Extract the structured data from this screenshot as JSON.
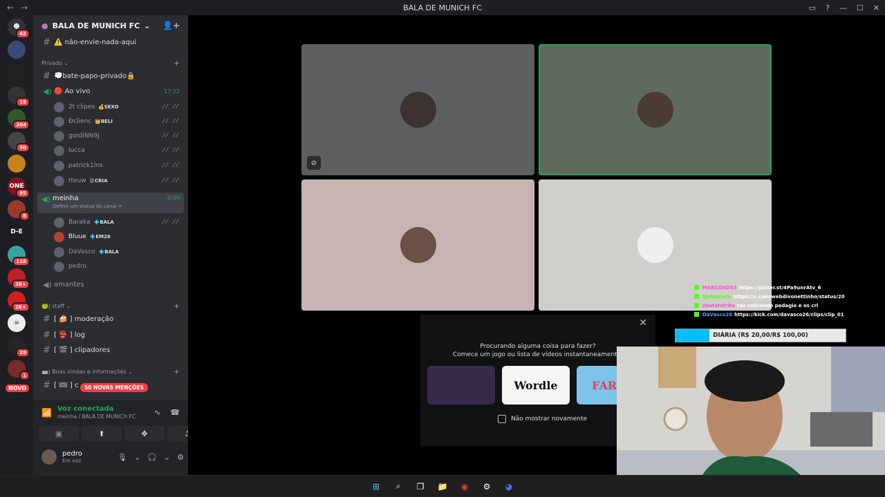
{
  "window": {
    "title": "BALA DE MUNICH FC"
  },
  "server": {
    "name": "BALA DE MUNICH FC"
  },
  "guild_badges": [
    "42",
    "15",
    "204",
    "50",
    "95",
    "8",
    "116",
    "2K+",
    "2K+",
    "29",
    "1"
  ],
  "guild_label": "D-E",
  "novo_label": "NOVO",
  "channels": {
    "top_channel": "⚠️ não-envie-nada-aqui",
    "cat_privado": "Privado",
    "bate_papo": "💭bate-papo-privado🔒",
    "ao_vivo": {
      "name": "🔴 Ao vivo",
      "time": "17:22"
    },
    "ao_vivo_users": [
      {
        "name": "2t clipes",
        "tag": "💰SEXO"
      },
      {
        "name": "Ðclienc",
        "tag": "👑BELI"
      },
      {
        "name": "gordiNN9j",
        "tag": ""
      },
      {
        "name": "lucca",
        "tag": ""
      },
      {
        "name": "patrick1lns",
        "tag": ""
      },
      {
        "name": "tteuw",
        "tag": "😮CRIA"
      }
    ],
    "meinha": {
      "name": "meinha",
      "time": "0:00",
      "status": "Definir um status do canal ✏"
    },
    "meinha_users": [
      {
        "name": "Baraka",
        "tag": "💠BALA"
      },
      {
        "name": "Bluue",
        "tag": "💠EM26"
      },
      {
        "name": "DaVasco",
        "tag": "💠BALA"
      },
      {
        "name": "pedro",
        "tag": ""
      }
    ],
    "amantes": "amantes",
    "cat_staff": "🐸| staff",
    "moderacao": "[ 🍰 ] moderação",
    "log": "[ 👺 ] log",
    "clipadores": "[ 🎬 ] clipadores",
    "cat_boas_vindas": "🚌| Boas vindas e informações",
    "partial_channel": "[ 🎟 ] c",
    "mentions_badge": "50 NOVAS MENÇÕES"
  },
  "voice_panel": {
    "title": "Voz conectada",
    "subtitle": "meinha / BALA DE MUNICH FC"
  },
  "user": {
    "name": "pedro",
    "status": "Em voz"
  },
  "popup": {
    "line1": "Procurando alguma coisa para fazer?",
    "line2": "Comece um jogo ou lista de vídeos instantaneamente.",
    "activities": [
      "",
      "Wordle",
      "FARM"
    ],
    "checkbox_label": "Não mostrar novamente"
  },
  "chat": [
    {
      "user": "MARCOXD03",
      "color": "#ff4fd8",
      "text": "https://pinter.st/4Pa9unrAtv_6"
    },
    {
      "user": "igatopreto",
      "color": "#53fc18",
      "text": "https://x.com/webdivonettinho/status/20"
    },
    {
      "user": "zbatatafrita",
      "color": "#ff4fd8",
      "text": "tao cobrando pedagio e os crl"
    },
    {
      "user": "DaVasco26",
      "color": "#4aa3ff",
      "text": "https://kick.com/davasco26/clips/clip_01"
    }
  ],
  "goal": {
    "label": "DIÁRIA (R$ 20,00/R$ 100,00)",
    "progress": 0.2
  },
  "colors": {
    "bg_guilds": "#1e1f22",
    "bg_sidebar": "#2b2d31",
    "accent_green": "#23a55a",
    "badge_red": "#f23f43",
    "goal_fill": "#00bfff"
  }
}
